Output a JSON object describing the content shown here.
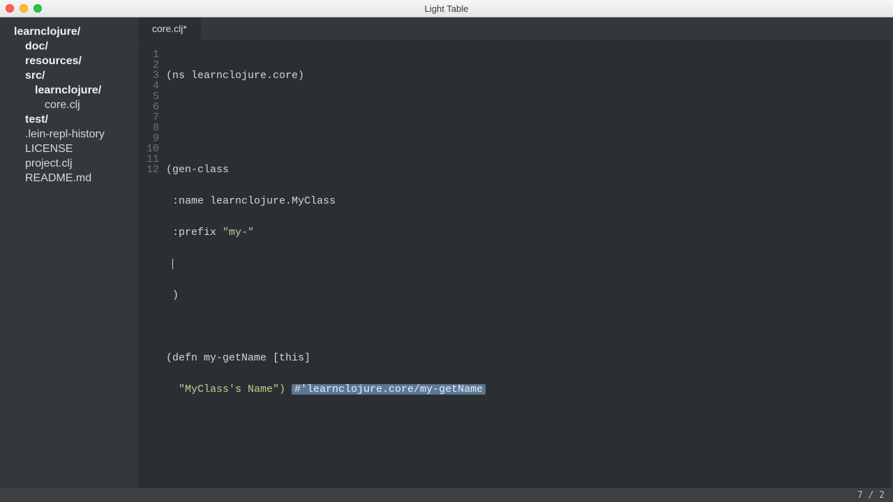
{
  "window": {
    "title": "Light Table"
  },
  "sidebar": {
    "items": [
      {
        "label": "learnclojure/",
        "indent": 0,
        "bold": true
      },
      {
        "label": "doc/",
        "indent": 1,
        "bold": true
      },
      {
        "label": "resources/",
        "indent": 1,
        "bold": true
      },
      {
        "label": "src/",
        "indent": 1,
        "bold": true
      },
      {
        "label": "learnclojure/",
        "indent": 2,
        "bold": true
      },
      {
        "label": "core.clj",
        "indent": 3,
        "bold": false
      },
      {
        "label": "test/",
        "indent": 1,
        "bold": true
      },
      {
        "label": ".lein-repl-history",
        "indent": 1,
        "bold": false
      },
      {
        "label": "LICENSE",
        "indent": 1,
        "bold": false
      },
      {
        "label": "project.clj",
        "indent": 1,
        "bold": false
      },
      {
        "label": "README.md",
        "indent": 1,
        "bold": false
      }
    ]
  },
  "tabs": {
    "active": {
      "label": "core.clj*"
    }
  },
  "editor": {
    "line_count": 12,
    "cursor_line": 7,
    "cursor_col": 2,
    "lines": {
      "l1_ns_open": "(ns ",
      "l1_ns_name": "learnclojure.core",
      "l1_close": ")",
      "l4_open": "(",
      "l4_gen": "gen-class",
      "l5_name_kw": " :name ",
      "l5_name_val": "learnclojure.MyClass",
      "l6_prefix_kw": " :prefix ",
      "l6_prefix_val": "\"my-\"",
      "l8_close": " )",
      "l10_open": "(defn ",
      "l10_fn": "my-getName ",
      "l10_args": "[this]",
      "l11_body": "  \"MyClass's Name\") ",
      "l11_eval": "#'learnclojure.core/my-getName"
    }
  },
  "status": {
    "position": "7 / 2"
  }
}
